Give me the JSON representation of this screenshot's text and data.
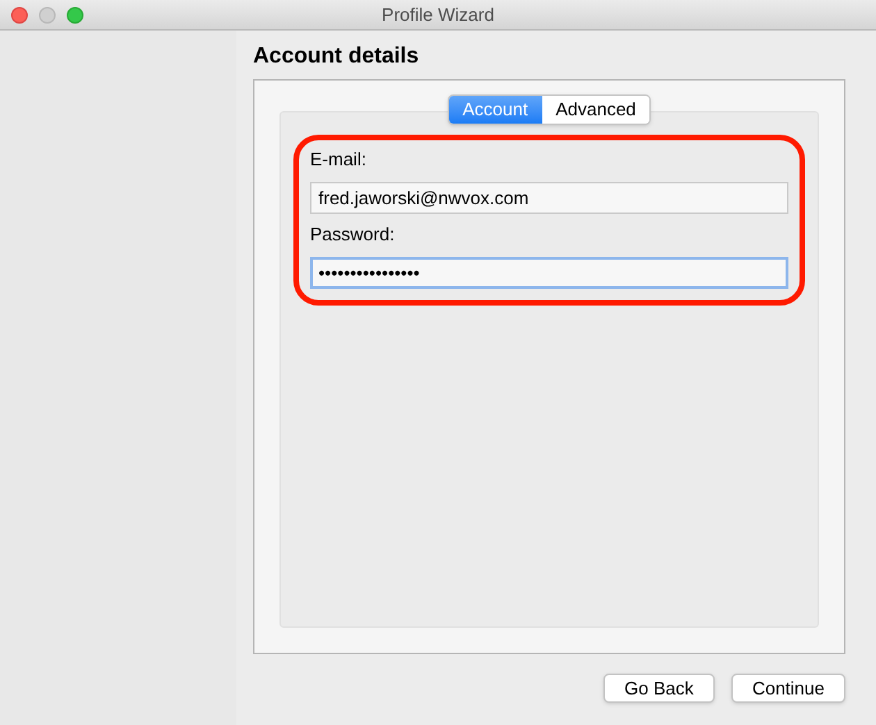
{
  "window": {
    "title": "Profile Wizard"
  },
  "page_title": "Account details",
  "tabs": [
    {
      "label": "Account",
      "selected": true
    },
    {
      "label": "Advanced",
      "selected": false
    }
  ],
  "form": {
    "highlighted": true,
    "fields": [
      {
        "label": "E-mail:",
        "value": "fred.jaworski@nwvox.com",
        "focused": false
      },
      {
        "label": "Password:",
        "value": "••••••••••••••••",
        "focused": true
      }
    ]
  },
  "buttons": [
    "Go Back",
    "Continue"
  ]
}
